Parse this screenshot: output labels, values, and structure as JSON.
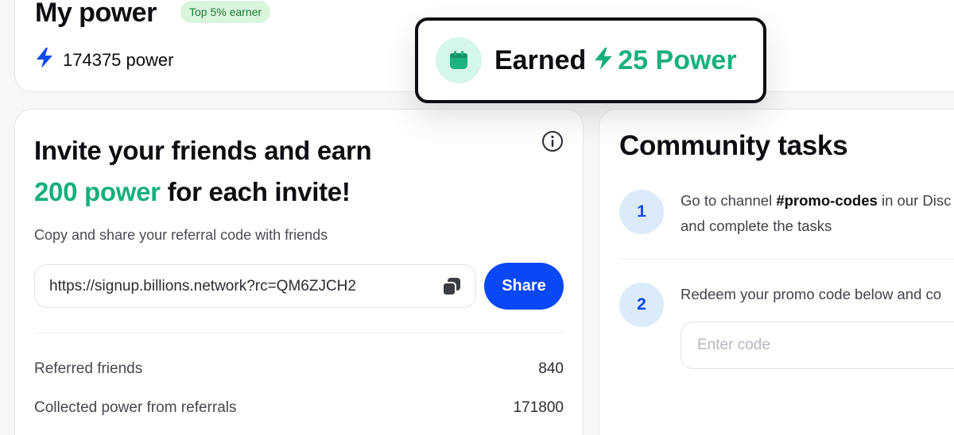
{
  "my_power": {
    "title": "My power",
    "badge": "Top 5% earner",
    "value_label": "174375 power"
  },
  "toast": {
    "earned": "Earned",
    "value": "25 Power"
  },
  "invite": {
    "heading_line1": "Invite your friends and earn",
    "heading_accent": "200 power",
    "heading_rest": " for each invite!",
    "subtitle": "Copy and share your referral code with friends",
    "referral_link": "https://signup.billions.network?rc=QM6ZJCH2",
    "share_label": "Share",
    "stats": [
      {
        "label": "Referred friends",
        "value": "840"
      },
      {
        "label": "Collected power from referrals",
        "value": "171800"
      }
    ]
  },
  "community": {
    "title": "Community tasks",
    "steps": [
      {
        "number": "1",
        "line1_prefix": "Go to channel ",
        "line1_bold": "#promo-codes",
        "line1_suffix": " in our Disc",
        "line2": "and complete the tasks"
      },
      {
        "number": "2",
        "line1": "Redeem your promo code below and co"
      }
    ],
    "code_placeholder": "Enter code"
  },
  "colors": {
    "accent_green": "#16b07a",
    "brand_blue": "#0a47f5",
    "badge_bg": "#d9f5dc"
  },
  "icons": {
    "power": "lightning-bolt-icon",
    "toast": "calendar-icon",
    "info": "info-icon",
    "copy": "copy-icon"
  }
}
